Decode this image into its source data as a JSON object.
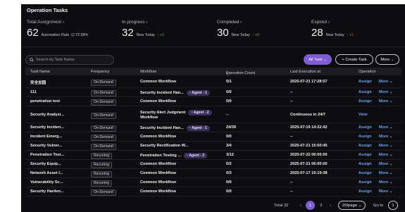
{
  "title": "Operation Tasks",
  "stats": {
    "total": {
      "label": "Total Assignment",
      "value": "62",
      "sub": "Automation Rate",
      "rate": "72.58%"
    },
    "in_progress": {
      "label": "In progress",
      "value": "32",
      "sub": "New Today",
      "delta": "+1"
    },
    "completed": {
      "label": "Completed",
      "value": "30",
      "sub": "New Today",
      "delta": "+0"
    },
    "expired": {
      "label": "Expired",
      "value": "28",
      "sub": "New Today",
      "delta": "+1"
    }
  },
  "search": {
    "placeholder": "Search by Task Name"
  },
  "buttons": {
    "all_task": "All Task",
    "create_task": "+ Create Task",
    "more": "More"
  },
  "columns": {
    "task_name": "Task Name",
    "frequency": "Frequency",
    "workflow": "Workflow",
    "execution_count": "Execution Count",
    "last_execution": "Last Execution at",
    "operation": "Operation"
  },
  "rows": [
    {
      "name": "安全加固",
      "frequency": "On-Demand",
      "workflow": "Common Workflow",
      "agent": "",
      "count": "0/1",
      "last": "2025-07-21 17:28:57",
      "assign": "Assign",
      "more": "More"
    },
    {
      "name": "111",
      "frequency": "On-Demand",
      "workflow": "Security Incident Han...",
      "agent": "Agent - 1",
      "count": "0/0",
      "last": "--",
      "assign": "Assign",
      "more": "More"
    },
    {
      "name": "penetration test",
      "frequency": "On-Demand",
      "workflow": "Common Workflow",
      "agent": "",
      "count": "0/0",
      "last": "--",
      "assign": "Assign",
      "more": "More"
    },
    {
      "name": "Security Analysi...",
      "frequency": "On-Demand",
      "workflow": "Security Alert Judgment",
      "workflow2": "Workflow",
      "agent": "Agent - 2",
      "count": "--",
      "last": "Continuous in 24/7",
      "assign": "View",
      "more": ""
    },
    {
      "name": "Security Inciden...",
      "frequency": "On-Demand",
      "workflow": "Security Incident Han...",
      "agent": "Agent - 1",
      "count": "24/39",
      "last": "2025-07-19 14:22:42",
      "assign": "Assign",
      "more": "More"
    },
    {
      "name": "Incident Emerg...",
      "frequency": "On-Demand",
      "workflow": "Common Workflow",
      "agent": "",
      "count": "0/0",
      "last": "--",
      "assign": "Assign",
      "more": "More"
    },
    {
      "name": "Security Vulner...",
      "frequency": "On-Demand",
      "workflow": "Security Rectification W...",
      "agent": "",
      "count": "3/4",
      "last": "2025-07-21 15:50:45",
      "assign": "Assign",
      "more": "More"
    },
    {
      "name": "Penetration Test...",
      "frequency": "Recurring",
      "workflow": "Penetration Testing ...",
      "agent": "Agent - 2",
      "count": "3/12",
      "last": "2025-07-22 06:00:00",
      "assign": "Assign",
      "more": "More"
    },
    {
      "name": "Security Equip...",
      "frequency": "Recurring",
      "workflow": "Common Workflow",
      "agent": "",
      "count": "0/2",
      "last": "2025-07-21 06:00:00",
      "assign": "Assign",
      "more": "More"
    },
    {
      "name": "Network Asset I...",
      "frequency": "Recurring",
      "workflow": "Common Workflow",
      "agent": "",
      "count": "0/3",
      "last": "2025-07-17 19:19:38",
      "assign": "Assign",
      "more": "More"
    },
    {
      "name": "Vulnerability Sc...",
      "frequency": "Recurring",
      "workflow": "Common Workflow",
      "agent": "",
      "count": "0/0",
      "last": "--",
      "assign": "Assign",
      "more": "More"
    },
    {
      "name": "Security Harden...",
      "frequency": "On-Demand",
      "workflow": "Common Workflow",
      "agent": "",
      "count": "0/0",
      "last": "--",
      "assign": "Assign",
      "more": "More"
    }
  ],
  "pagination": {
    "total": "Total 32",
    "pages": [
      "1",
      "2"
    ],
    "page_size": "20/page",
    "goto_label": "Go to",
    "goto_value": "1"
  },
  "colors": {
    "accent": "#7d5cd6",
    "link": "#5aa8ff",
    "up": "#3fbf6a",
    "down": "#e04c4c",
    "background": "#0d0d10"
  }
}
